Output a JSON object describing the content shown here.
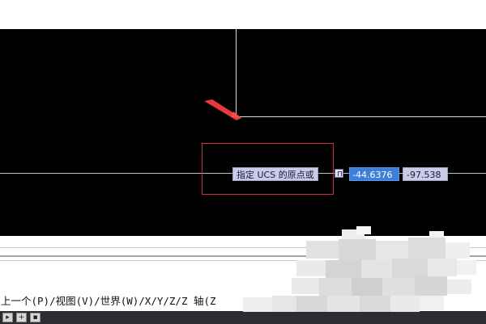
{
  "drawing_area": {
    "tooltip_prompt": "指定 UCS 的原点或",
    "input_icon": "dropdown-options-icon",
    "x_coordinate": "-44.6376",
    "y_coordinate": "-97.538"
  },
  "command_line": {
    "text": "上一个(P)/视图(V)/世界(W)/X/Y/Z/Z 轴(Z"
  },
  "status_bar": {
    "buttons": [
      "▸",
      "+",
      "▪"
    ]
  },
  "colors": {
    "canvas": "#000000",
    "highlight_box": "#c8323c",
    "arrow": "#e83a3a",
    "tooltip_bg": "#c9cbe8",
    "coord_selected": "#3f7fdc"
  }
}
